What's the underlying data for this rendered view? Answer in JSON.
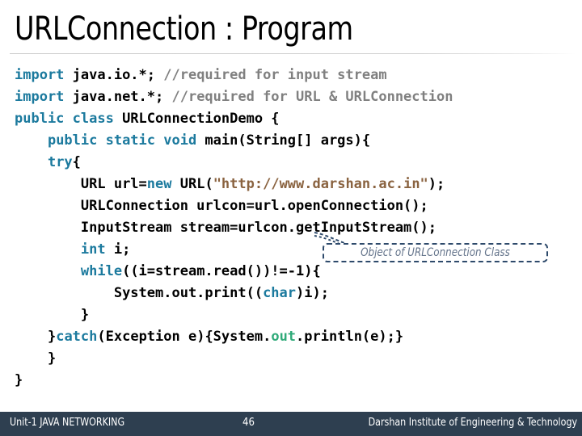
{
  "slide": {
    "title": "URLConnection : Program"
  },
  "code": {
    "language": "java",
    "lines": [
      {
        "indent": 0,
        "tokens": [
          {
            "t": "import",
            "c": "kw"
          },
          {
            "t": " java.io.*; ",
            "c": "plain"
          },
          {
            "t": "//required for input stream",
            "c": "cmt"
          }
        ]
      },
      {
        "indent": 0,
        "tokens": [
          {
            "t": "import",
            "c": "kw"
          },
          {
            "t": " java.net.*; ",
            "c": "plain"
          },
          {
            "t": "//required for URL & URLConnection",
            "c": "cmt"
          }
        ]
      },
      {
        "indent": 0,
        "tokens": [
          {
            "t": "public class",
            "c": "kw"
          },
          {
            "t": " URLConnectionDemo {",
            "c": "plain"
          }
        ]
      },
      {
        "indent": 1,
        "tokens": [
          {
            "t": "public static void",
            "c": "kw"
          },
          {
            "t": " main(String[] args){",
            "c": "plain"
          }
        ]
      },
      {
        "indent": 1,
        "tokens": [
          {
            "t": "try",
            "c": "kw"
          },
          {
            "t": "{",
            "c": "plain"
          }
        ]
      },
      {
        "indent": 2,
        "tokens": [
          {
            "t": "URL url=",
            "c": "plain"
          },
          {
            "t": "new",
            "c": "kw"
          },
          {
            "t": " URL(",
            "c": "plain"
          },
          {
            "t": "\"http://www.darshan.ac.in\"",
            "c": "str"
          },
          {
            "t": ");",
            "c": "plain"
          }
        ]
      },
      {
        "indent": 2,
        "tokens": [
          {
            "t": "URLConnection urlcon=url.openConnection();",
            "c": "plain"
          }
        ]
      },
      {
        "indent": 2,
        "tokens": [
          {
            "t": "InputStream stream=urlcon.getInputStream();",
            "c": "plain"
          }
        ]
      },
      {
        "indent": 2,
        "tokens": [
          {
            "t": "int",
            "c": "kw"
          },
          {
            "t": " i;",
            "c": "plain"
          }
        ]
      },
      {
        "indent": 2,
        "tokens": [
          {
            "t": "while",
            "c": "kw"
          },
          {
            "t": "((i=stream.read())!=-1){",
            "c": "plain"
          }
        ]
      },
      {
        "indent": 3,
        "tokens": [
          {
            "t": "System.out.print((",
            "c": "plain"
          },
          {
            "t": "char",
            "c": "kw"
          },
          {
            "t": ")i);",
            "c": "plain"
          }
        ]
      },
      {
        "indent": 2,
        "tokens": [
          {
            "t": "}",
            "c": "plain"
          }
        ]
      },
      {
        "indent": 1,
        "tokens": [
          {
            "t": "}",
            "c": "plain"
          },
          {
            "t": "catch",
            "c": "kw"
          },
          {
            "t": "(Exception e){System.",
            "c": "plain"
          },
          {
            "t": "out",
            "c": "grn"
          },
          {
            "t": ".println(e);}",
            "c": "plain"
          }
        ]
      },
      {
        "indent": 1,
        "tokens": [
          {
            "t": "}",
            "c": "plain"
          }
        ]
      },
      {
        "indent": 0,
        "tokens": [
          {
            "t": "}",
            "c": "plain"
          }
        ]
      }
    ]
  },
  "callout": {
    "text": "Object of URLConnection Class"
  },
  "footer": {
    "left": "Unit-1 JAVA NETWORKING",
    "page": "46",
    "right": "Darshan Institute of Engineering & Technology"
  },
  "colors": {
    "keyword": "#1c7a9e",
    "comment": "#808080",
    "string": "#8a6340",
    "green": "#2faa79",
    "footer_bar": "#2e3f50",
    "callout_border": "#2e4a6b",
    "callout_text": "#64748b"
  }
}
